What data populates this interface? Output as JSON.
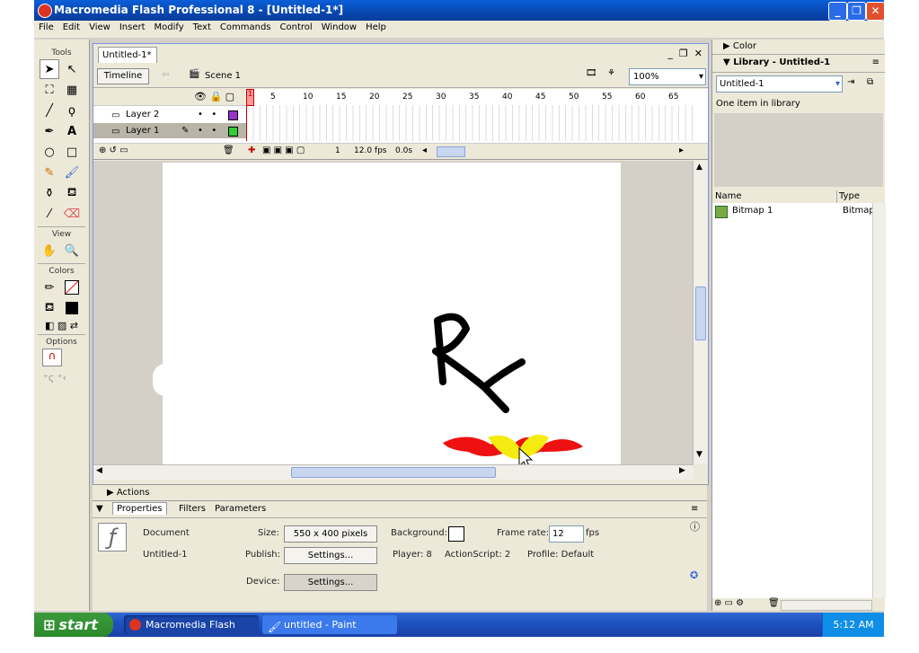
{
  "window": {
    "title": "Macromedia Flash Professional 8 - [Untitled-1*]"
  },
  "menu": [
    "File",
    "Edit",
    "View",
    "Insert",
    "Modify",
    "Text",
    "Commands",
    "Control",
    "Window",
    "Help"
  ],
  "tools": {
    "header": "Tools",
    "view_header": "View",
    "colors_header": "Colors",
    "options_header": "Options"
  },
  "document": {
    "tab": "Untitled-1*",
    "timeline_button": "Timeline",
    "scene": "Scene 1",
    "zoom": "100%",
    "layers": [
      {
        "name": "Layer 2",
        "color": "#9933cc"
      },
      {
        "name": "Layer 1",
        "color": "#33cc33"
      }
    ],
    "frame_numbers": [
      "1",
      "5",
      "10",
      "15",
      "20",
      "25",
      "30",
      "35",
      "40",
      "45",
      "50",
      "55",
      "60",
      "65"
    ],
    "status": {
      "frame": "1",
      "fps": "12.0 fps",
      "time": "0.0s"
    }
  },
  "actions_label": "Actions",
  "properties": {
    "tabs": [
      "Properties",
      "Filters",
      "Parameters"
    ],
    "doc_label": "Document",
    "doc_name": "Untitled-1",
    "size_label": "Size:",
    "size_value": "550 x 400 pixels",
    "background_label": "Background:",
    "framerate_label": "Frame rate:",
    "framerate_value": "12",
    "fps_label": "fps",
    "publish_label": "Publish:",
    "settings_button": "Settings...",
    "player": "Player: 8",
    "actionscript": "ActionScript: 2",
    "profile": "Profile: Default",
    "device_label": "Device:",
    "device_button": "Settings..."
  },
  "library": {
    "color_panel": "Color",
    "title": "Library - Untitled-1",
    "doc_select": "Untitled-1",
    "count": "One item in library",
    "col_name": "Name",
    "col_type": "Type",
    "items": [
      {
        "name": "Bitmap 1",
        "type": "Bitmap"
      }
    ]
  },
  "taskbar": {
    "start": "start",
    "tasks": [
      "Macromedia Flash Pro...",
      "untitled - Paint"
    ],
    "clock": "5:12 AM"
  }
}
